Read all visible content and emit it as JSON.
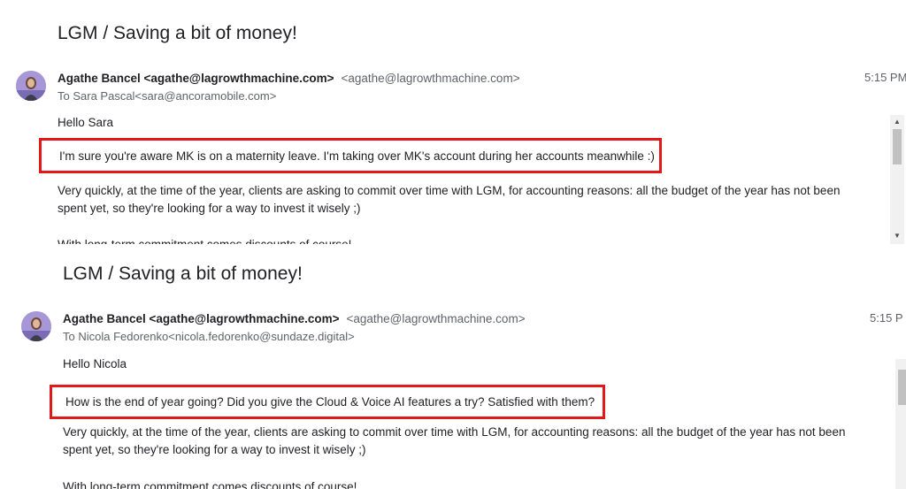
{
  "emails": [
    {
      "subject": "LGM / Saving a bit of money!",
      "sender_name": "Agathe Bancel <agathe@lagrowthmachine.com>",
      "sender_email": "<agathe@lagrowthmachine.com>",
      "to": "To Sara Pascal<sara@ancoramobile.com>",
      "time": "5:15 PM",
      "greeting": "Hello Sara",
      "highlighted": "I'm sure you're aware MK is on a maternity leave. I'm taking over MK's account during her accounts meanwhile :)",
      "paragraph": "Very quickly, at the time of the year, clients are asking to commit over time with LGM, for accounting reasons: all the budget of the year has not been spent yet, so they're looking for a way to invest it wisely ;)",
      "cutoff": "With long-term commitment comes discounts of course!"
    },
    {
      "subject": "LGM / Saving a bit of money!",
      "sender_name": "Agathe Bancel <agathe@lagrowthmachine.com>",
      "sender_email": "<agathe@lagrowthmachine.com>",
      "to": "To Nicola Fedorenko<nicola.fedorenko@sundaze.digital>",
      "time": "5:15 P",
      "greeting": "Hello Nicola",
      "highlighted": "How is the end of year going? Did you give the Cloud & Voice AI features a try? Satisfied with them?",
      "paragraph": "Very quickly, at the time of the year, clients are asking to commit over time with LGM, for accounting reasons: all the budget of the year has not been spent yet, so they're looking for a way to invest it wisely ;)",
      "cutoff": "With long-term commitment comes discounts of course!"
    }
  ],
  "icons": {
    "avatar": "avatar-photo",
    "scroll_up": "▲",
    "scroll_down": "▼"
  },
  "colors": {
    "highlight_border": "#e0191b",
    "secondary_text": "#5f6368"
  }
}
